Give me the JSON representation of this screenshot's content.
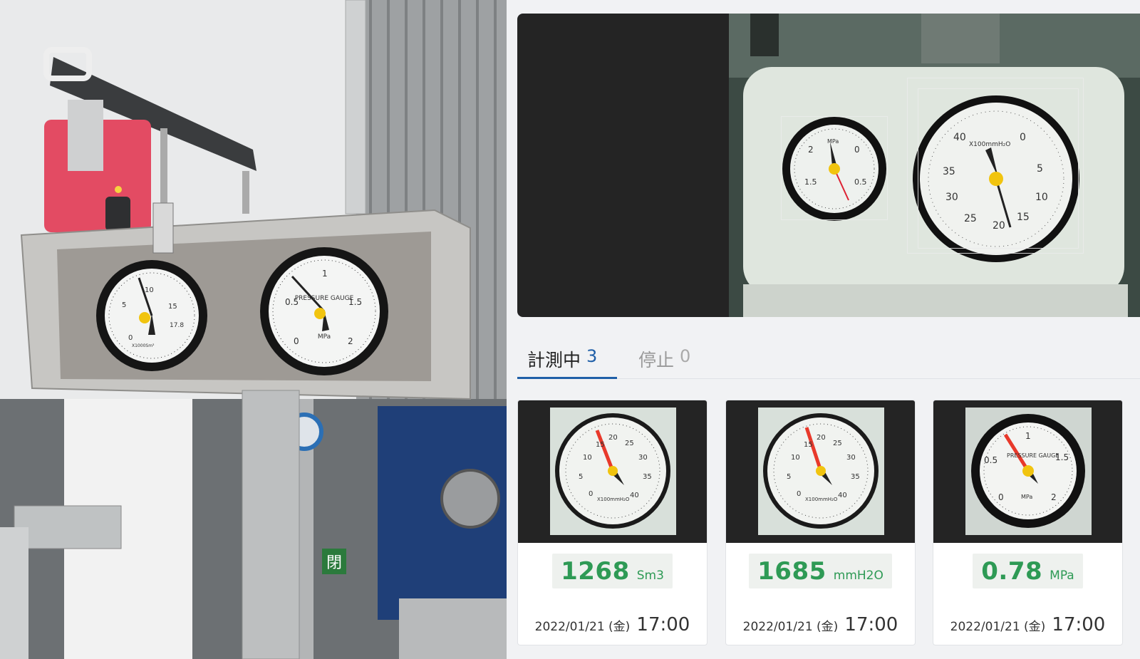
{
  "tabs": [
    {
      "label": "計測中",
      "count": "3"
    },
    {
      "label": "停止",
      "count": "0"
    }
  ],
  "left_photo": {
    "gauge_left": {
      "scale_labels": [
        "5",
        "10",
        "15",
        "0",
        "17.8"
      ],
      "unit": "X1000Sm³"
    },
    "gauge_right": {
      "title": "PRESSURE GAUGE",
      "scale_labels": [
        "0.5",
        "1",
        "1.5",
        "0",
        "2"
      ],
      "unit": "MPa"
    },
    "valve_tag": "閉"
  },
  "camera": {
    "gauge_small": {
      "scale_labels": [
        "2",
        "0",
        "1.5",
        "0.5"
      ],
      "unit": "MPa"
    },
    "gauge_large": {
      "scale_labels": [
        "40",
        "0",
        "35",
        "5",
        "30",
        "10",
        "25",
        "20",
        "15"
      ],
      "unit": "X100mmH₂O"
    }
  },
  "cards": [
    {
      "value": "1268",
      "unit": "Sm3",
      "date": "2022/01/21 (金)",
      "time": "17:00",
      "thumb_unit": "X100mmH₂O"
    },
    {
      "value": "1685",
      "unit": "mmH2O",
      "date": "2022/01/21 (金)",
      "time": "17:00",
      "thumb_unit": "X100mmH₂O"
    },
    {
      "value": "0.78",
      "unit": "MPa",
      "date": "2022/01/21 (金)",
      "time": "17:00",
      "thumb_unit": "MPa"
    }
  ],
  "colors": {
    "accent": "#1f5fa8",
    "reading": "#2e9a55",
    "needle": "#e8392b"
  }
}
